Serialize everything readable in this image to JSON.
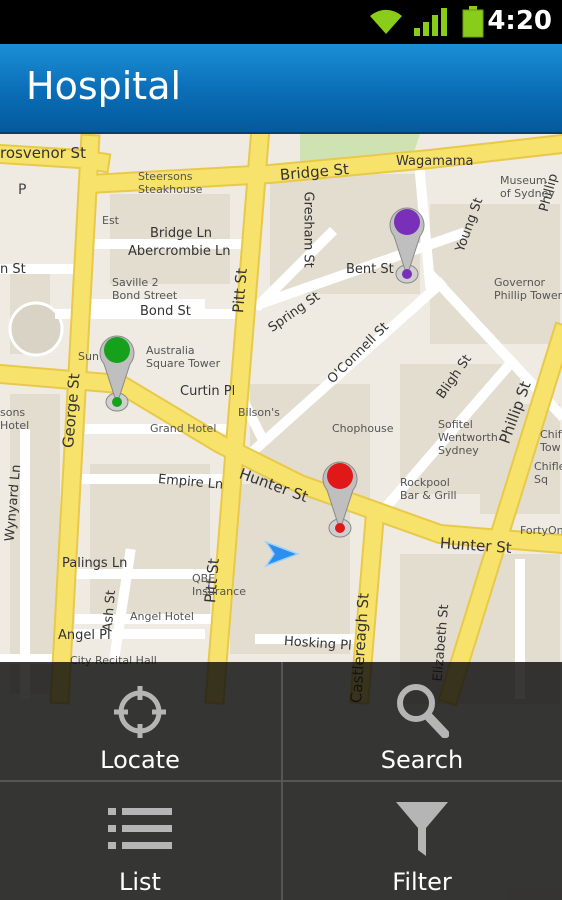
{
  "status_bar": {
    "time": "4:20"
  },
  "title_bar": {
    "title": "Hospital"
  },
  "map": {
    "streets": [
      {
        "id": "grosvenor",
        "text": "rosvenor St"
      },
      {
        "id": "bridge",
        "text": "Bridge St"
      },
      {
        "id": "wagamama",
        "text": "Wagamama"
      },
      {
        "id": "bridge-ln",
        "text": "Bridge Ln"
      },
      {
        "id": "abercrombie",
        "text": "Abercrombie Ln"
      },
      {
        "id": "gresham",
        "text": "Gresham St"
      },
      {
        "id": "bent",
        "text": "Bent St"
      },
      {
        "id": "young",
        "text": "Young St"
      },
      {
        "id": "phillip-top",
        "text": "Phillip"
      },
      {
        "id": "n-st",
        "text": "n St"
      },
      {
        "id": "bond",
        "text": "Bond St"
      },
      {
        "id": "spring",
        "text": "Spring St"
      },
      {
        "id": "oconnell",
        "text": "O'Connell St"
      },
      {
        "id": "bligh",
        "text": "Bligh St"
      },
      {
        "id": "pitt-top",
        "text": "Pitt St"
      },
      {
        "id": "curtin",
        "text": "Curtin Pl"
      },
      {
        "id": "george",
        "text": "George St"
      },
      {
        "id": "phillip",
        "text": "Phillip St"
      },
      {
        "id": "hunter",
        "text": "Hunter St"
      },
      {
        "id": "hunter-right",
        "text": "Hunter St"
      },
      {
        "id": "empire",
        "text": "Empire Ln"
      },
      {
        "id": "wynyard",
        "text": "Wynyard Ln"
      },
      {
        "id": "pitt-mid",
        "text": "Pitt St"
      },
      {
        "id": "palings",
        "text": "Palings Ln"
      },
      {
        "id": "ash",
        "text": "Ash St"
      },
      {
        "id": "castlereagh",
        "text": "Castlereagh St"
      },
      {
        "id": "elizabeth",
        "text": "Elizabeth St"
      },
      {
        "id": "hosking",
        "text": "Hosking Pl"
      },
      {
        "id": "angel-pl",
        "text": "Angel Pl"
      }
    ],
    "pois": [
      {
        "id": "steersons",
        "text": "Steersons\nSteakhouse"
      },
      {
        "id": "museum",
        "text": "Museum\nof Sydney"
      },
      {
        "id": "est",
        "text": "Est"
      },
      {
        "id": "saville",
        "text": "Saville 2\nBond Street"
      },
      {
        "id": "governor",
        "text": "Governor\nPhillip Tower"
      },
      {
        "id": "australia-sq",
        "text": "Australia\nSquare Tower"
      },
      {
        "id": "sun",
        "text": "Sun"
      },
      {
        "id": "bilsons",
        "text": "Bilson's"
      },
      {
        "id": "grand-hotel",
        "text": "Grand Hotel"
      },
      {
        "id": "chophouse",
        "text": "Chophouse"
      },
      {
        "id": "sofitel",
        "text": "Sofitel\nWentworth\nSydney"
      },
      {
        "id": "sons-hotel",
        "text": "sons\nHotel"
      },
      {
        "id": "chif",
        "text": "Chif\nTow"
      },
      {
        "id": "chifle",
        "text": "Chifle\nSq"
      },
      {
        "id": "rockpool",
        "text": "Rockpool\nBar & Grill"
      },
      {
        "id": "fortyone",
        "text": "FortyOn"
      },
      {
        "id": "qbe",
        "text": "QBE\nInsurance"
      },
      {
        "id": "angel-hotel",
        "text": "Angel Hotel"
      },
      {
        "id": "city-recital",
        "text": "City Recital Hall"
      },
      {
        "id": "p",
        "text": "P"
      }
    ],
    "pins": [
      {
        "id": "purple",
        "color": "#7a2fb8"
      },
      {
        "id": "green",
        "color": "#16a11c"
      },
      {
        "id": "red",
        "color": "#e01818"
      }
    ]
  },
  "menu": {
    "locate": "Locate",
    "search": "Search",
    "list": "List",
    "filter": "Filter"
  },
  "colors": {
    "title_bar": "#0a6db6",
    "major_road": "#f7e26b",
    "minor_road": "#ffffff",
    "map_bg": "#efebe2"
  }
}
